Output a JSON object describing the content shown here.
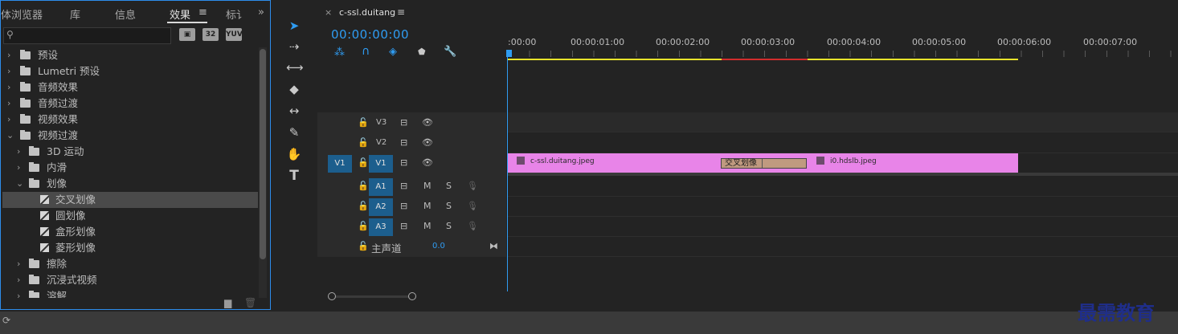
{
  "effects_panel": {
    "tabs": [
      "媒体浏览器",
      "库",
      "信息",
      "效果",
      "标记"
    ],
    "tab_truncated": [
      "体浏览器",
      "库",
      "信息",
      "效果",
      "标讠"
    ],
    "active_tab": "效果",
    "search": {
      "value": "",
      "placeholder": ""
    },
    "toolbar_buttons": [
      "32",
      "YUV"
    ],
    "tree": [
      {
        "label": "预设",
        "level": 0,
        "type": "star-folder",
        "expanded": false
      },
      {
        "label": "Lumetri 预设",
        "level": 0,
        "type": "star-folder",
        "expanded": false
      },
      {
        "label": "音频效果",
        "level": 0,
        "type": "folder",
        "expanded": false
      },
      {
        "label": "音频过渡",
        "level": 0,
        "type": "folder",
        "expanded": false
      },
      {
        "label": "视频效果",
        "level": 0,
        "type": "folder",
        "expanded": false
      },
      {
        "label": "视频过渡",
        "level": 0,
        "type": "folder",
        "expanded": true
      },
      {
        "label": "3D 运动",
        "level": 1,
        "type": "folder",
        "expanded": false
      },
      {
        "label": "内滑",
        "level": 1,
        "type": "folder",
        "expanded": false
      },
      {
        "label": "划像",
        "level": 1,
        "type": "folder",
        "expanded": true
      },
      {
        "label": "交叉划像",
        "level": 2,
        "type": "effect",
        "selected": true
      },
      {
        "label": "圆划像",
        "level": 2,
        "type": "effect"
      },
      {
        "label": "盒形划像",
        "level": 2,
        "type": "effect"
      },
      {
        "label": "菱形划像",
        "level": 2,
        "type": "effect"
      },
      {
        "label": "擦除",
        "level": 1,
        "type": "folder",
        "expanded": false
      },
      {
        "label": "沉浸式视频",
        "level": 1,
        "type": "folder",
        "expanded": false
      },
      {
        "label": "溶解",
        "level": 1,
        "type": "folder",
        "expanded": false
      }
    ]
  },
  "timeline": {
    "sequence_tab": "c-ssl.duitang",
    "timecode": "00:00:00:00",
    "ruler": [
      ":00:00",
      "00:00:01:00",
      "00:00:02:00",
      "00:00:03:00",
      "00:00:04:00",
      "00:00:05:00",
      "00:00:06:00",
      "00:00:07:00"
    ],
    "tracks_video": [
      "V3",
      "V2",
      "V1"
    ],
    "tracks_audio": [
      "A1",
      "A2",
      "A3"
    ],
    "source_patch": "V1",
    "mute": "M",
    "solo": "S",
    "master": {
      "label": "主声道",
      "value": "0.0"
    },
    "clips": [
      {
        "name": "c-ssl.duitang.jpeg",
        "track": "V1",
        "start": 0,
        "end": 3.0
      },
      {
        "name": "i0.hdslb.jpeg",
        "track": "V1",
        "start": 3.0,
        "end": 6.0
      }
    ],
    "transition": {
      "name": "交叉划像",
      "track": "V1"
    },
    "colors": {
      "accent": "#2f9cf2",
      "clip": "#e884e8",
      "track_target": "#1c5e8d",
      "render_yellow": "#e8e32b",
      "render_red": "#d22d2d"
    }
  },
  "watermark": "最需教育"
}
